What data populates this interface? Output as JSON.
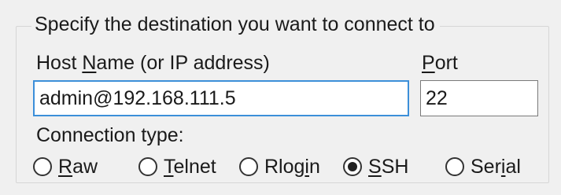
{
  "destination": {
    "group_title": "Specify the destination you want to connect to",
    "host_label": "Host Name (or IP address)",
    "host_value": "admin@192.168.111.5",
    "port_label": "Port",
    "port_value": "22"
  },
  "connection_type": {
    "label": "Connection type:",
    "options": [
      {
        "label": "Raw",
        "checked": false
      },
      {
        "label": "Telnet",
        "checked": false
      },
      {
        "label": "Rlogin",
        "checked": false
      },
      {
        "label": "SSH",
        "checked": true
      },
      {
        "label": "Serial",
        "checked": false
      }
    ]
  },
  "colors": {
    "focus_border": "#3c8fd9",
    "panel_background": "#f0f0f0"
  }
}
